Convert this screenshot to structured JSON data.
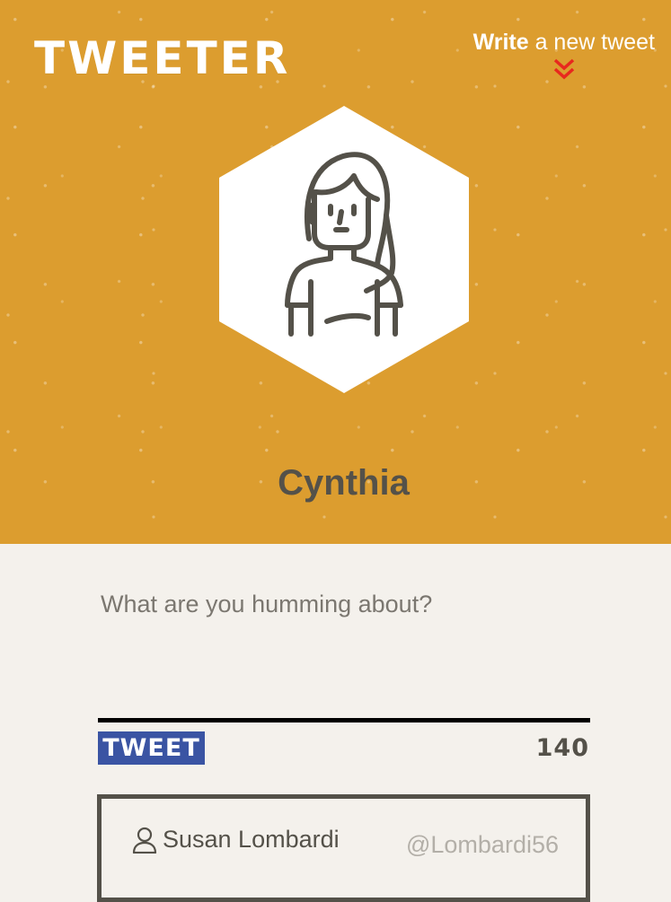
{
  "header": {
    "logo_text": "TWEETER",
    "write_link": {
      "strong": "Write",
      "rest": " a new tweet",
      "icon": "double-chevron-down-icon"
    },
    "avatar_icon": "woman-avatar-icon",
    "user_name": "Cynthia"
  },
  "compose": {
    "placeholder": "What are you humming about?",
    "value": "",
    "submit_label": "TWEET",
    "char_count": "140"
  },
  "tweets": [
    {
      "author_icon": "user-icon",
      "author_name": "Susan Lombardi",
      "handle": "@Lombardi56"
    }
  ],
  "colors": {
    "header_bg": "#dc9d2f",
    "page_bg": "#f4f1ec",
    "text_dark": "#545149",
    "button_bg": "#3a54a3",
    "chevron": "#e8281e",
    "handle_text": "#b3afa8"
  }
}
